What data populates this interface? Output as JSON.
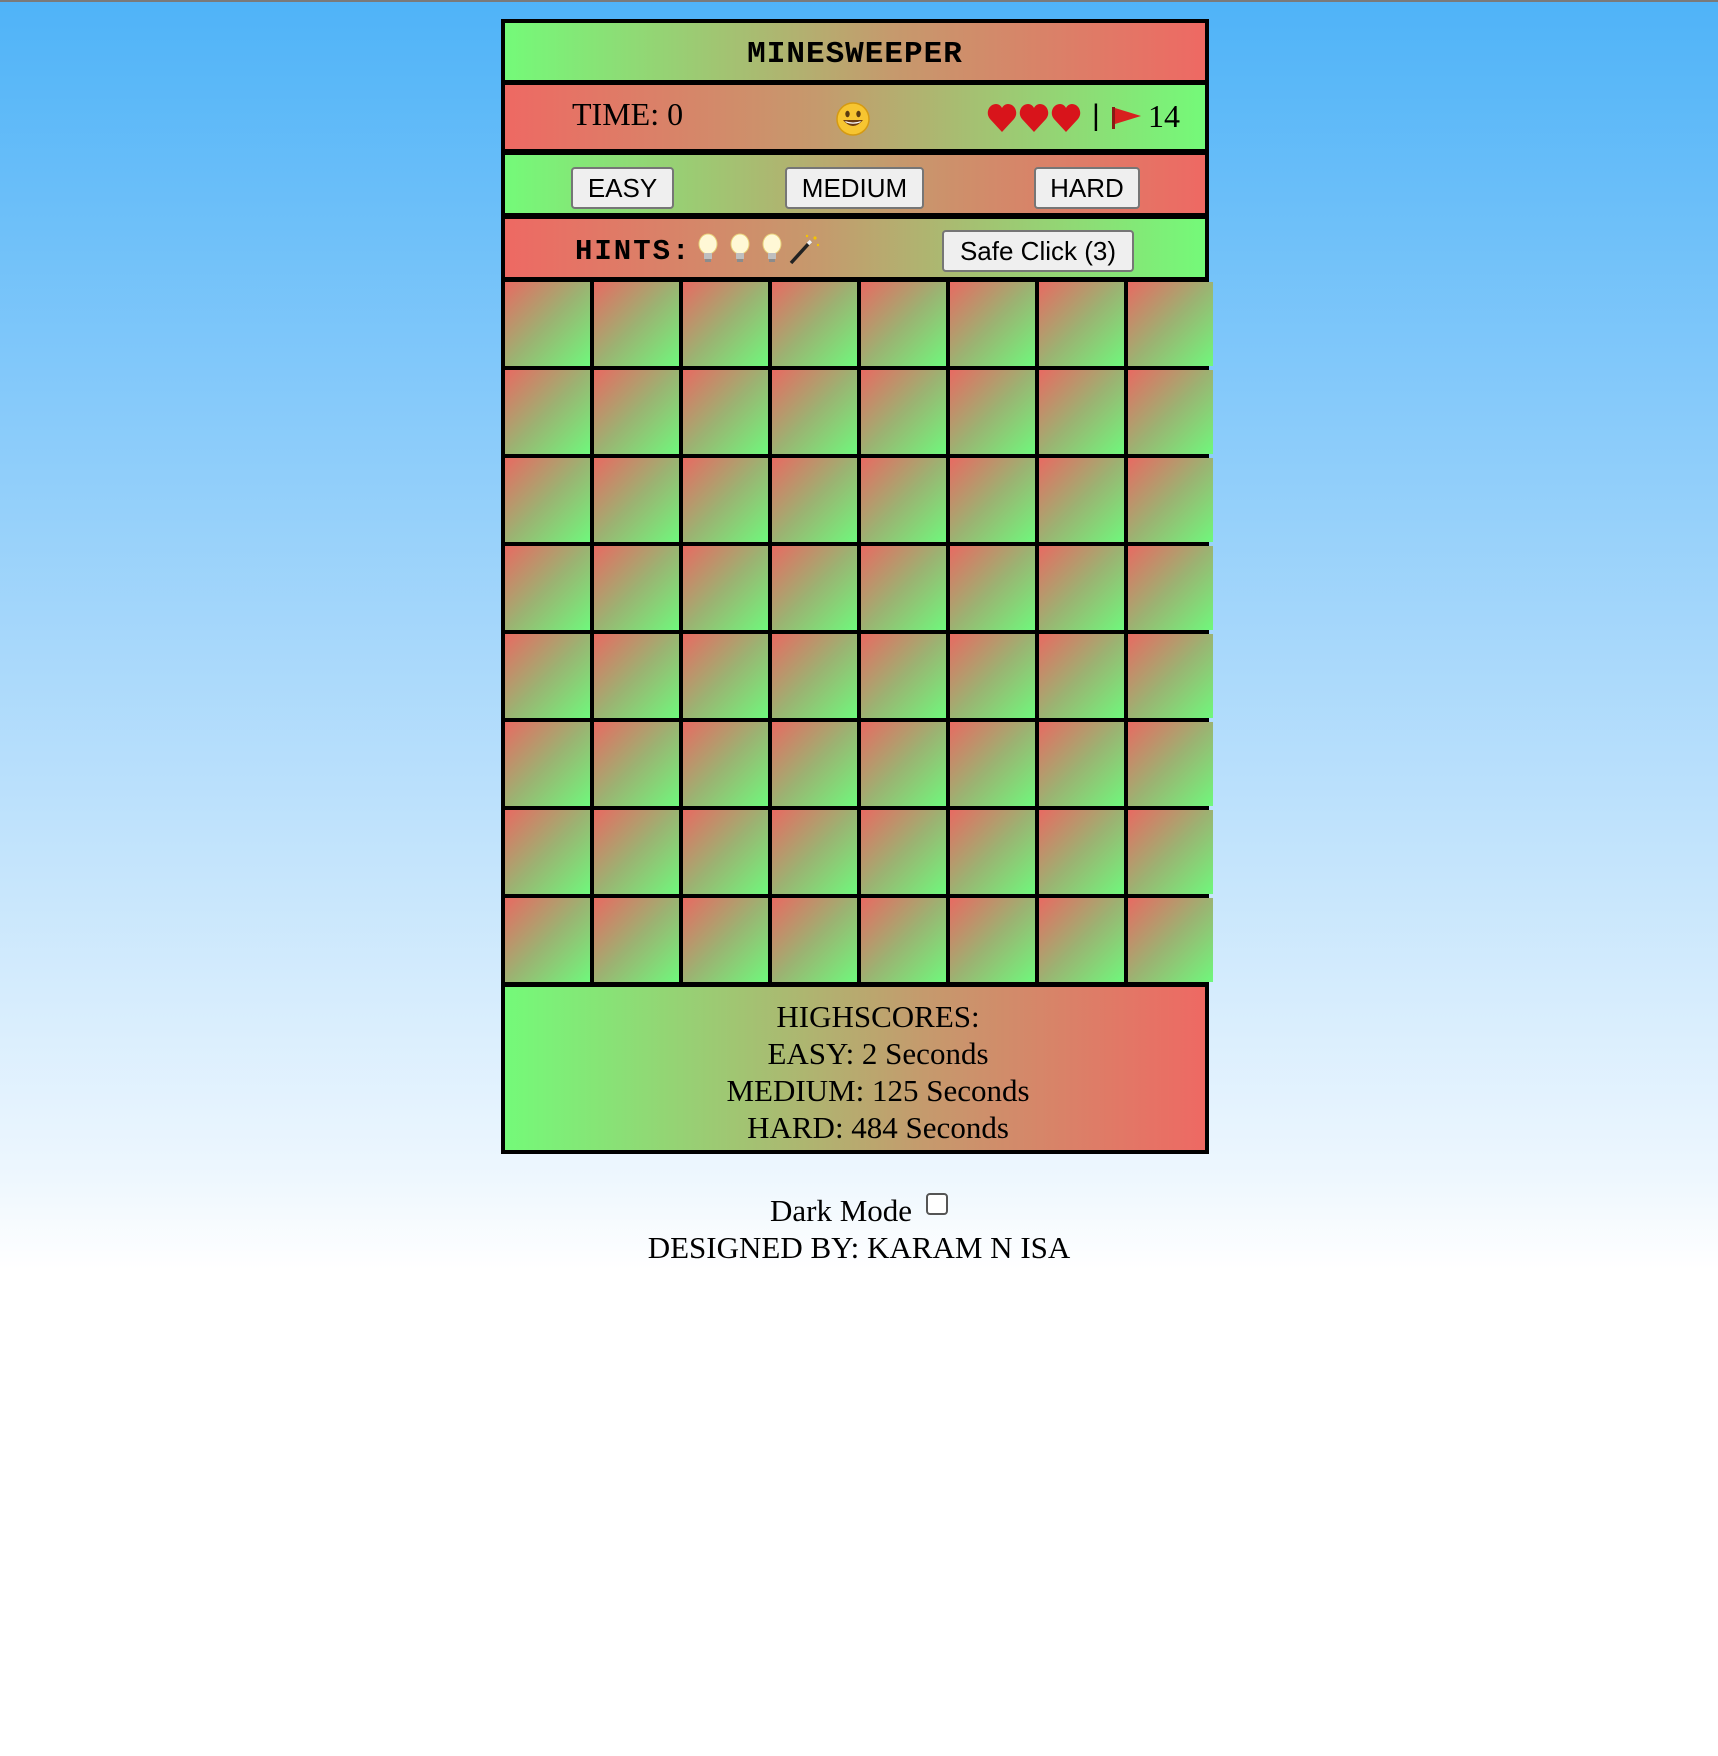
{
  "header": {
    "title": "MINESWEEPER"
  },
  "status": {
    "time_label": "TIME: 0",
    "face_icon": "smiley-face-icon",
    "lives": 3,
    "separator": "|",
    "flag_icon": "red-flag-icon",
    "flags_remaining": "14"
  },
  "difficulty": {
    "easy_label": "EASY",
    "medium_label": "MEDIUM",
    "hard_label": "HARD"
  },
  "hints": {
    "label": "HINTS:",
    "bulbs": 3,
    "wand_icon": "magic-wand-icon",
    "safe_click_label": "Safe Click (3)"
  },
  "board": {
    "rows": 8,
    "cols": 8,
    "state": "all-covered"
  },
  "highscores": {
    "heading": "HIGHSCORES:",
    "easy": "EASY: 2 Seconds",
    "medium": "MEDIUM: 125 Seconds",
    "hard": "HARD: 484 Seconds"
  },
  "footer": {
    "dark_mode_label": "Dark Mode",
    "dark_mode_checked": false,
    "credits": "DESIGNED BY: KARAM N ISA"
  },
  "colors": {
    "tile_red": "#e86a62",
    "tile_green": "#6ff87c",
    "bar_green": "#74fa79",
    "bar_red": "#ee6963"
  }
}
